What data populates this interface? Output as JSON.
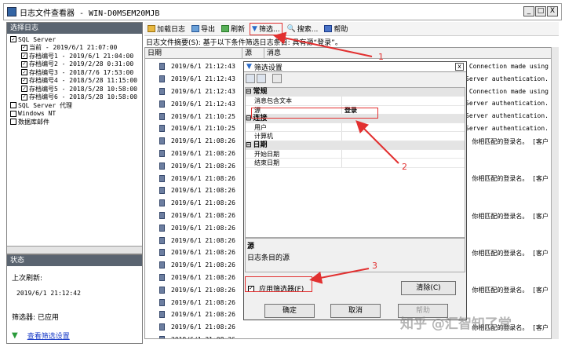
{
  "window": {
    "title": "日志文件查看器 - WIN-D0MSEM20MJB",
    "controls": [
      "_",
      "□",
      "X"
    ]
  },
  "left_panel": {
    "title": "选择日志",
    "items": [
      {
        "label": "SQL Server",
        "checked": true,
        "level": 0
      },
      {
        "label": "当前 - 2019/6/1 21:07:00",
        "checked": true,
        "level": 1
      },
      {
        "label": "存档编号1 - 2019/6/1 21:04:00",
        "checked": true,
        "level": 1
      },
      {
        "label": "存档编号2 - 2019/2/28 0:31:00",
        "checked": true,
        "level": 1
      },
      {
        "label": "存档编号3 - 2018/7/6 17:53:00",
        "checked": true,
        "level": 1
      },
      {
        "label": "存档编号4 - 2018/5/28 11:15:00",
        "checked": true,
        "level": 1
      },
      {
        "label": "存档编号5 - 2018/5/28 10:58:00",
        "checked": true,
        "level": 1
      },
      {
        "label": "存档编号6 - 2018/5/28 10:58:00",
        "checked": true,
        "level": 1
      },
      {
        "label": "SQL Server 代理",
        "checked": false,
        "level": 0
      },
      {
        "label": "Windows NT",
        "checked": false,
        "level": 0
      },
      {
        "label": "数据库邮件",
        "checked": false,
        "level": 0
      }
    ]
  },
  "status_panel": {
    "title": "状态",
    "last_refresh_label": "上次刷新:",
    "last_refresh_value": "2019/6/1 21:12:42",
    "filter_label": "筛选器: 已应用",
    "view_filter_link": "查看筛选设置"
  },
  "toolbar": {
    "load": "加载日志",
    "export": "导出",
    "refresh": "刷新",
    "filter": "筛选...",
    "search": "搜索...",
    "help": "帮助"
  },
  "summary_text": "日志文件摘要(S): 基于以下条件筛选日志条目: 具有源“登录”。",
  "grid": {
    "headers": {
      "date": "日期",
      "source": "源",
      "message": "消息"
    },
    "dates": [
      "2019/6/1 21:12:43",
      "2019/6/1 21:12:43",
      "2019/6/1 21:12:43",
      "2019/6/1 21:12:43",
      "2019/6/1 21:10:25",
      "2019/6/1 21:10:25",
      "2019/6/1 21:08:26",
      "2019/6/1 21:08:26",
      "2019/6/1 21:08:26",
      "2019/6/1 21:08:26",
      "2019/6/1 21:08:26",
      "2019/6/1 21:08:26",
      "2019/6/1 21:08:26",
      "2019/6/1 21:08:26",
      "2019/6/1 21:08:26",
      "2019/6/1 21:08:26",
      "2019/6/1 21:08:26",
      "2019/6/1 21:08:26",
      "2019/6/1 21:08:26",
      "2019/6/1 21:08:26",
      "2019/6/1 21:08:26",
      "2019/6/1 21:08:26",
      "2019/6/1 21:08:26"
    ],
    "messages": [
      {
        "row": 0,
        "text": "Connection made using"
      },
      {
        "row": 1,
        "text": "Server authentication."
      },
      {
        "row": 2,
        "text": "Connection made using"
      },
      {
        "row": 3,
        "text": "Server authentication."
      },
      {
        "row": 4,
        "text": "Server authentication."
      },
      {
        "row": 5,
        "text": "Server authentication."
      },
      {
        "row": 6,
        "text": "你相匹配的登录名。 [客户"
      },
      {
        "row": 9,
        "text": "你相匹配的登录名。 [客户"
      },
      {
        "row": 12,
        "text": "你相匹配的登录名。 [客户"
      },
      {
        "row": 15,
        "text": "你相匹配的登录名。 [客户"
      },
      {
        "row": 18,
        "text": "你相匹配的登录名。 [客户"
      },
      {
        "row": 21,
        "text": "你相匹配的登录名。 [客户"
      }
    ]
  },
  "dialog": {
    "title": "筛选设置",
    "close": "x",
    "categories": [
      {
        "name": "常规",
        "props": [
          {
            "key": "消息包含文本",
            "value": ""
          },
          {
            "key": "源",
            "value": "登录"
          }
        ]
      },
      {
        "name": "连接",
        "props": [
          {
            "key": "用户",
            "value": ""
          },
          {
            "key": "计算机",
            "value": ""
          }
        ]
      },
      {
        "name": "日期",
        "props": [
          {
            "key": "开始日期",
            "value": ""
          },
          {
            "key": "结束日期",
            "value": ""
          }
        ]
      }
    ],
    "desc_title": "源",
    "desc_text": "日志条目的源",
    "apply_label": "应用筛选器(F)",
    "apply_checked": true,
    "clear_btn": "清除(C)",
    "ok_btn": "确定",
    "cancel_btn": "取消",
    "help_btn": "帮助"
  },
  "annotations": [
    "1",
    "2",
    "3"
  ],
  "watermark": "知乎 @汇智知了堂",
  "colors": {
    "annotation_red": "#e23030",
    "panel_title": "#5a6470"
  }
}
